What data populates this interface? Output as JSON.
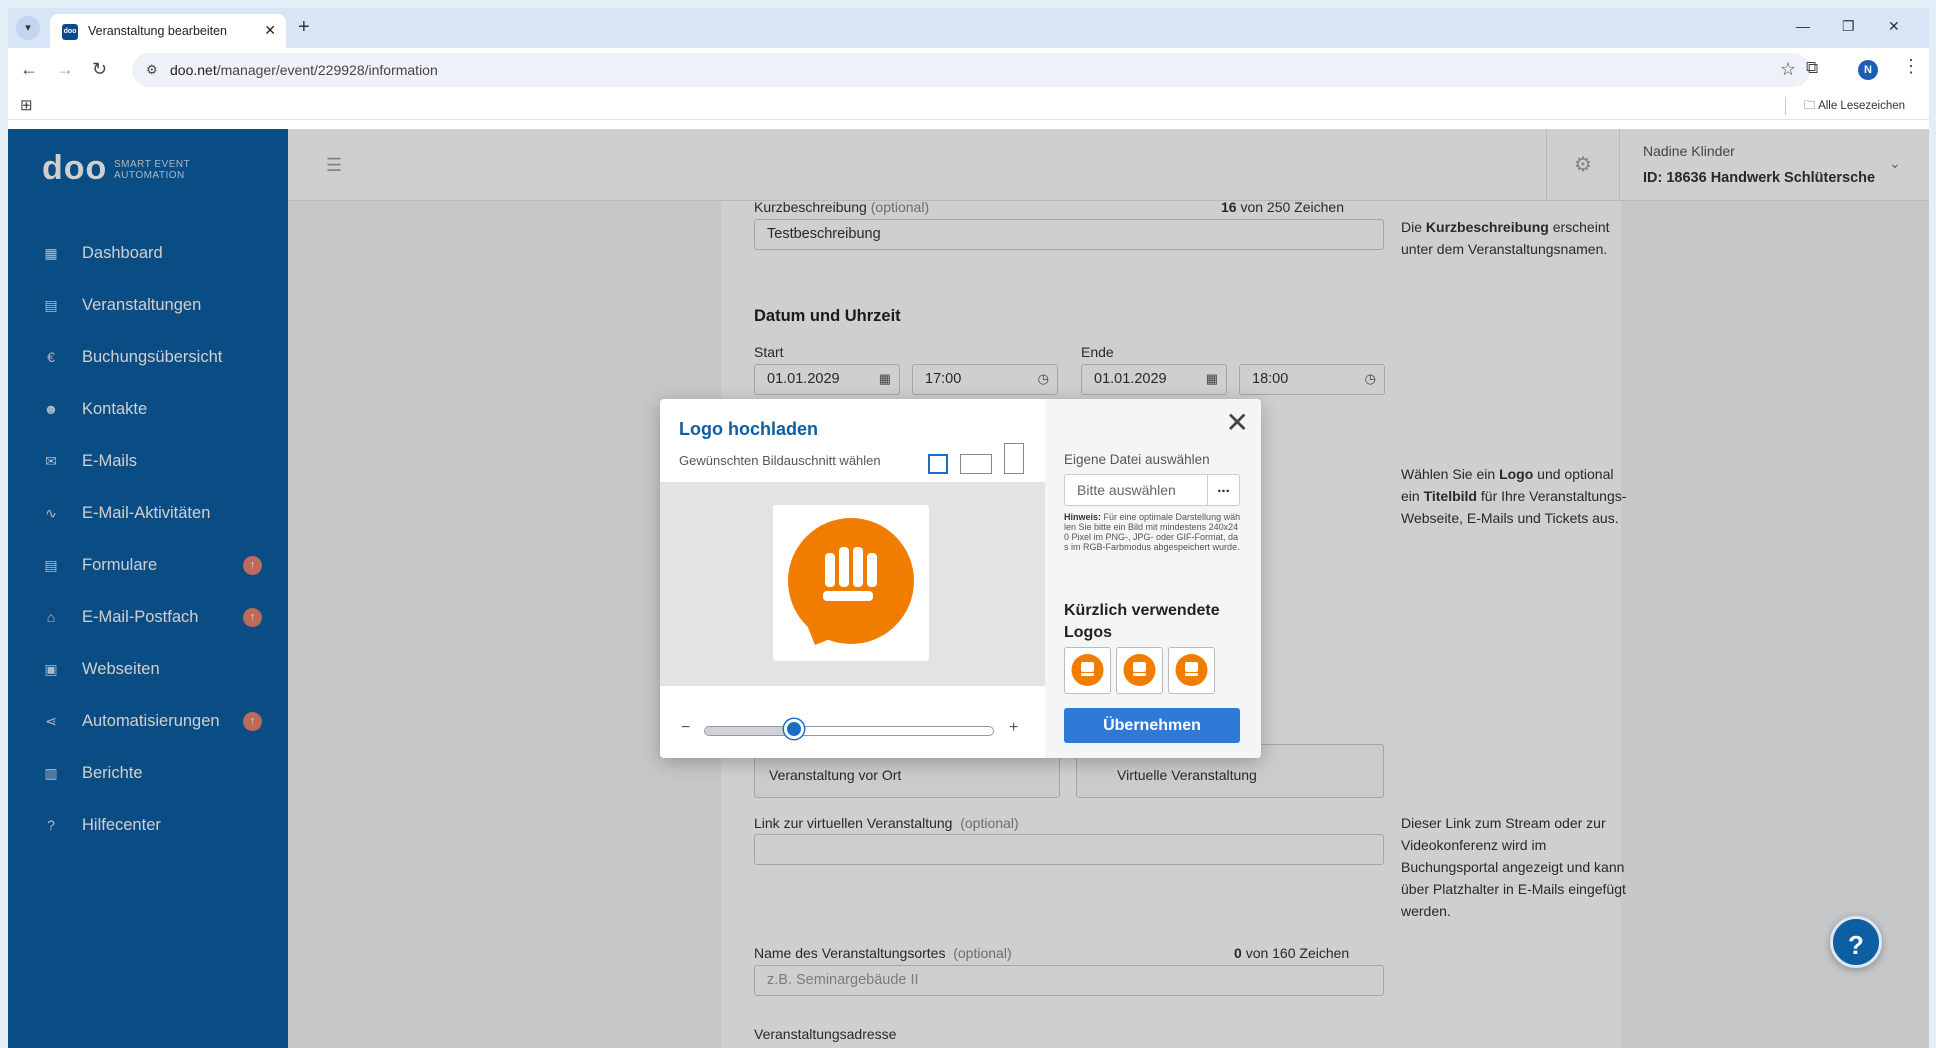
{
  "browser": {
    "tab_title": "Veranstaltung bearbeiten",
    "tab_favicon_text": "doo",
    "url_host": "doo.net",
    "url_path": "/manager/event/229928/information",
    "bookmarks_label": "Alle Lesezeichen",
    "profile_initial": "N"
  },
  "brand": {
    "name": "doo",
    "tagline": "SMART EVENT AUTOMATION"
  },
  "sidebar": {
    "items": [
      {
        "label": "Dashboard",
        "icon": "dashboard-icon",
        "badge": false
      },
      {
        "label": "Veranstaltungen",
        "icon": "calendar-icon",
        "badge": false
      },
      {
        "label": "Buchungsübersicht",
        "icon": "euro-icon",
        "badge": false
      },
      {
        "label": "Kontakte",
        "icon": "contacts-icon",
        "badge": false
      },
      {
        "label": "E-Mails",
        "icon": "mail-icon",
        "badge": false
      },
      {
        "label": "E-Mail-Aktivitäten",
        "icon": "activity-icon",
        "badge": false
      },
      {
        "label": "Formulare",
        "icon": "form-icon",
        "badge": true
      },
      {
        "label": "E-Mail-Postfach",
        "icon": "inbox-icon",
        "badge": true
      },
      {
        "label": "Webseiten",
        "icon": "website-icon",
        "badge": false
      },
      {
        "label": "Automatisierungen",
        "icon": "share-icon",
        "badge": true
      },
      {
        "label": "Berichte",
        "icon": "report-icon",
        "badge": false
      },
      {
        "label": "Hilfecenter",
        "icon": "help-icon",
        "badge": false
      }
    ]
  },
  "header": {
    "user_name": "Nadine Klinder",
    "account": "ID: 18636  Handwerk Schlütersche"
  },
  "form": {
    "short_desc_label": "Kurzbeschreibung",
    "optional": "(optional)",
    "short_desc_count": "16",
    "short_desc_max": "von 250 Zeichen",
    "short_desc_value": "Testbeschreibung",
    "short_desc_hint_pre": "Die ",
    "short_desc_hint_bold": "Kurzbeschreibung",
    "short_desc_hint_post": " erscheint unter dem Veranstaltungsnamen.",
    "date_section": "Datum und Uhrzeit",
    "start_label": "Start",
    "end_label": "Ende",
    "start_date": "01.01.2029",
    "start_time": "17:00",
    "end_date": "01.01.2029",
    "end_time": "18:00",
    "logo_hint_1": "Wählen Sie ein ",
    "logo_hint_logo": "Logo",
    "logo_hint_2": " und optional ein ",
    "logo_hint_title": "Titelbild",
    "logo_hint_3": " für Ihre Veranstaltungs-Webseite, E-Mails und Tickets aus.",
    "radio_onsite": "Veranstaltung vor Ort",
    "radio_virtual": "Virtuelle Veranstaltung",
    "virtual_link_label": "Link zur virtuellen Veranstaltung",
    "virtual_link_hint": "Dieser Link zum Stream oder zur Videokonferenz wird im Buchungsportal angezeigt und kann über Platzhalter in E-Mails eingefügt werden.",
    "venue_label": "Name des Veranstaltungsortes",
    "venue_count": "0",
    "venue_max": "von 160 Zeichen",
    "venue_placeholder": "z.B. Seminargebäude II",
    "address_label": "Veranstaltungsadresse"
  },
  "modal": {
    "title": "Logo hochladen",
    "crop_label": "Gewünschten Bildauschnitt wählen",
    "zoom_minus": "−",
    "zoom_plus": "+",
    "zoom_level": 0.31,
    "own_file_label": "Eigene Datei auswählen",
    "file_placeholder": "Bitte auswählen",
    "file_button": "...",
    "hint_bold": "Hinweis:",
    "hint_text": " Für eine optimale Darstellung wählen Sie bitte ein Bild mit mindestens 240x240 Pixel im PNG-, JPG- oder GIF-Format, das im RGB-Farbmodus abgespeichert wurde.",
    "recent_title": "Kürzlich verwendete Logos",
    "apply_button": "Übernehmen",
    "logo_color": "#f07d00"
  },
  "help_button": "?",
  "colors": {
    "sidebar": "#0d5ea3",
    "accent": "#2f7ad6",
    "badge": "#e8846f"
  }
}
